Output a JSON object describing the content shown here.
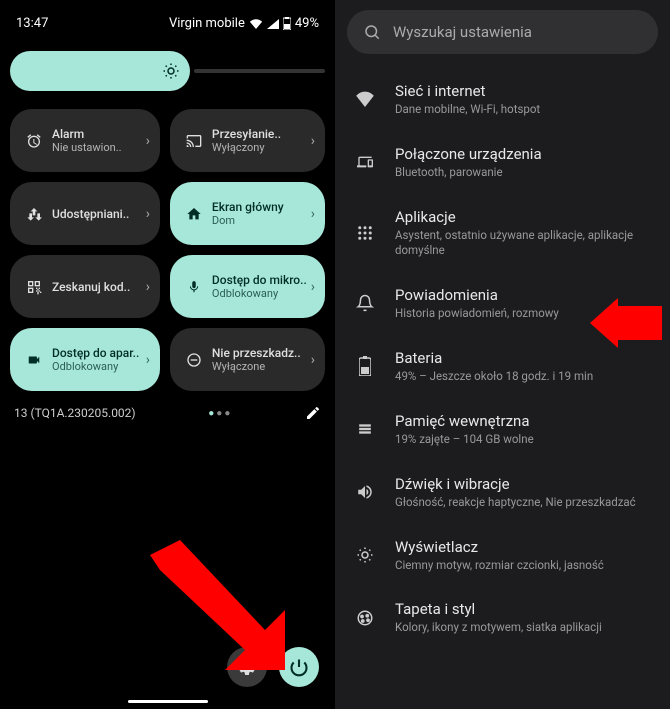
{
  "left": {
    "status": {
      "time": "13:47",
      "carrier": "Virgin mobile",
      "battery": "49%"
    },
    "tiles": [
      {
        "title": "Alarm",
        "sub": "Nie ustawion..",
        "active": false,
        "icon": "alarm"
      },
      {
        "title": "Przesyłanie..",
        "sub": "Wyłączony",
        "active": false,
        "icon": "cast"
      },
      {
        "title": "Udostępniani..",
        "sub": "",
        "active": false,
        "icon": "share"
      },
      {
        "title": "Ekran główny",
        "sub": "Dom",
        "active": true,
        "icon": "home"
      },
      {
        "title": "Zeskanuj kod..",
        "sub": "",
        "active": false,
        "icon": "qr"
      },
      {
        "title": "Dostęp do mikro..",
        "sub": "Odblokowany",
        "active": true,
        "icon": "mic"
      },
      {
        "title": "Dostęp do apar..",
        "sub": "Odblokowany",
        "active": true,
        "icon": "camera"
      },
      {
        "title": "Nie przeszkadz..",
        "sub": "Wyłączone",
        "active": false,
        "icon": "dnd"
      }
    ],
    "build": "13 (TQ1A.230205.002)"
  },
  "right": {
    "search_placeholder": "Wyszukaj ustawienia",
    "items": [
      {
        "title": "Sieć i internet",
        "sub": "Dane mobilne, Wi-Fi, hotspot",
        "icon": "wifi"
      },
      {
        "title": "Połączone urządzenia",
        "sub": "Bluetooth, parowanie",
        "icon": "devices"
      },
      {
        "title": "Aplikacje",
        "sub": "Asystent, ostatnio używane aplikacje, aplikacje domyślne",
        "icon": "apps"
      },
      {
        "title": "Powiadomienia",
        "sub": "Historia powiadomień, rozmowy",
        "icon": "bell"
      },
      {
        "title": "Bateria",
        "sub": "49% – Jeszcze około 18 godz. i 19 min",
        "icon": "battery"
      },
      {
        "title": "Pamięć wewnętrzna",
        "sub": "19% zajęte – 104 GB wolne",
        "icon": "storage"
      },
      {
        "title": "Dźwięk i wibracje",
        "sub": "Głośność, reakcje haptyczne, Nie przeszkadzać",
        "icon": "sound"
      },
      {
        "title": "Wyświetlacz",
        "sub": "Ciemny motyw, rozmiar czcionki, jasność",
        "icon": "display"
      },
      {
        "title": "Tapeta i styl",
        "sub": "Kolory, ikony z motywem, siatka aplikacji",
        "icon": "wallpaper"
      }
    ]
  }
}
